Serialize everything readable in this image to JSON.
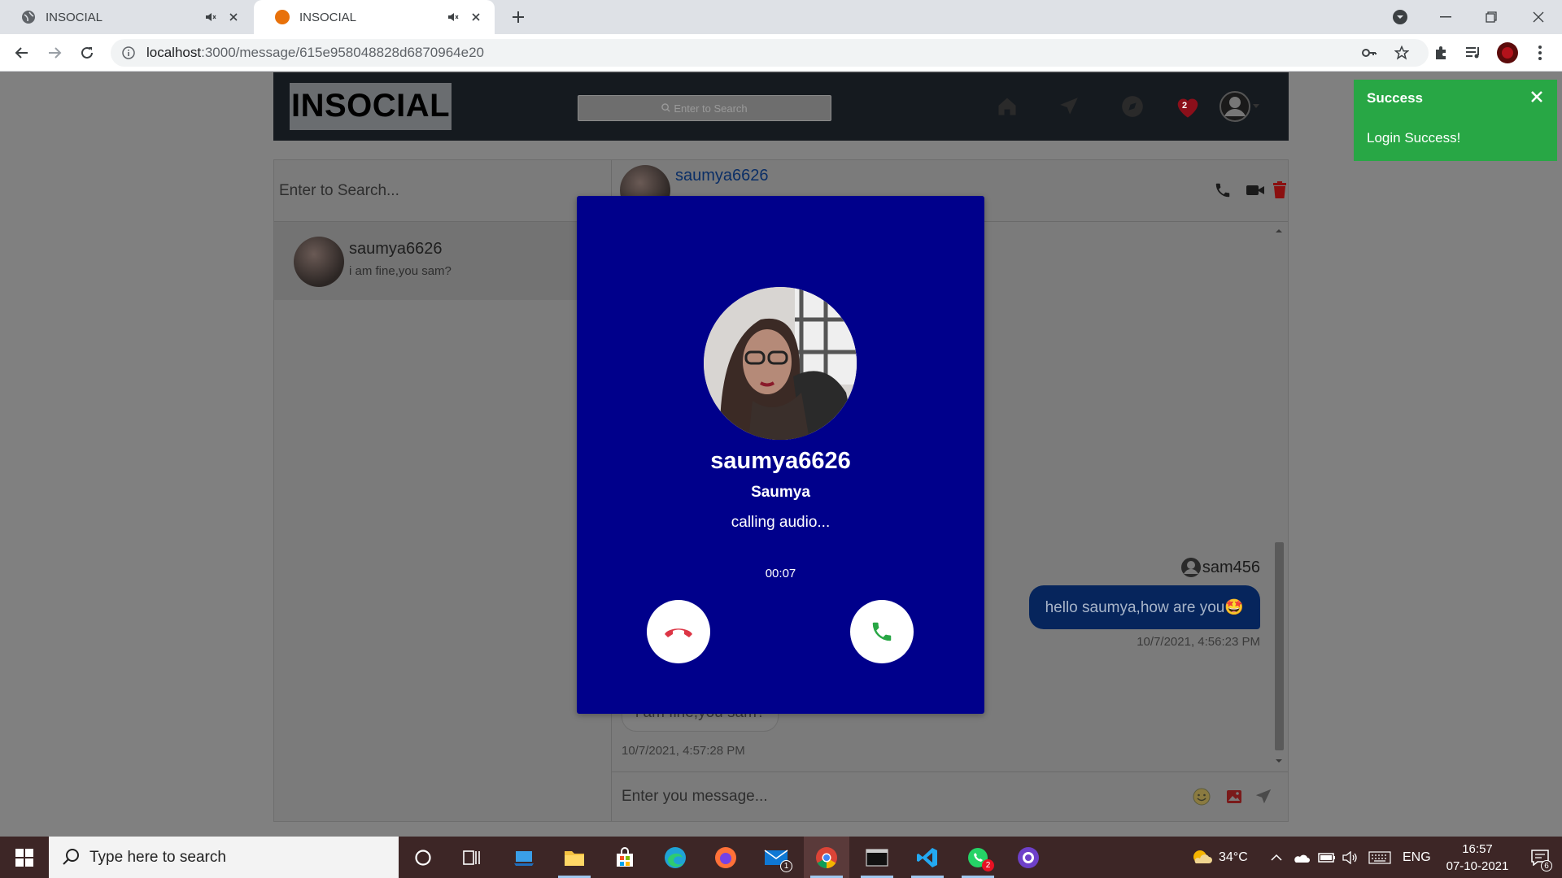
{
  "browser": {
    "tabs": [
      {
        "title": "INSOCIAL"
      },
      {
        "title": "INSOCIAL"
      }
    ],
    "url_host": "localhost",
    "url_path": ":3000/message/615e958048828d6870964e20"
  },
  "app": {
    "brand": "INSOCIAL",
    "nav_search_placeholder": "Enter to Search",
    "notification_count": "2"
  },
  "sidebar": {
    "search_placeholder": "Enter to Search...",
    "conversations": [
      {
        "username": "saumya6626",
        "last_message": "i am fine,you sam?"
      }
    ]
  },
  "chat": {
    "header_username": "saumya6626",
    "messages": [
      {
        "sender": "sam456",
        "text": "hello saumya,how are you🤩",
        "time": "10/7/2021, 4:56:23 PM"
      },
      {
        "text": "i am fine,you sam?",
        "time": "10/7/2021, 4:57:28 PM"
      }
    ],
    "composer_placeholder": "Enter you message..."
  },
  "toast": {
    "title": "Success",
    "message": "Login Success!"
  },
  "call": {
    "username": "saumya6626",
    "fullname": "Saumya",
    "status": "calling audio...",
    "timer": "00:07"
  },
  "taskbar": {
    "search_placeholder": "Type here to search",
    "mail_badge": "1",
    "whatsapp_badge": "2",
    "temperature": "34°C",
    "language": "ENG",
    "time": "16:57",
    "date": "07-10-2021",
    "notification_count": "6"
  },
  "colors": {
    "call_bg": "#00008b",
    "toast_bg": "#28a745",
    "my_bubble": "#06255c",
    "decline": "#dc3545",
    "accept": "#28a745"
  }
}
